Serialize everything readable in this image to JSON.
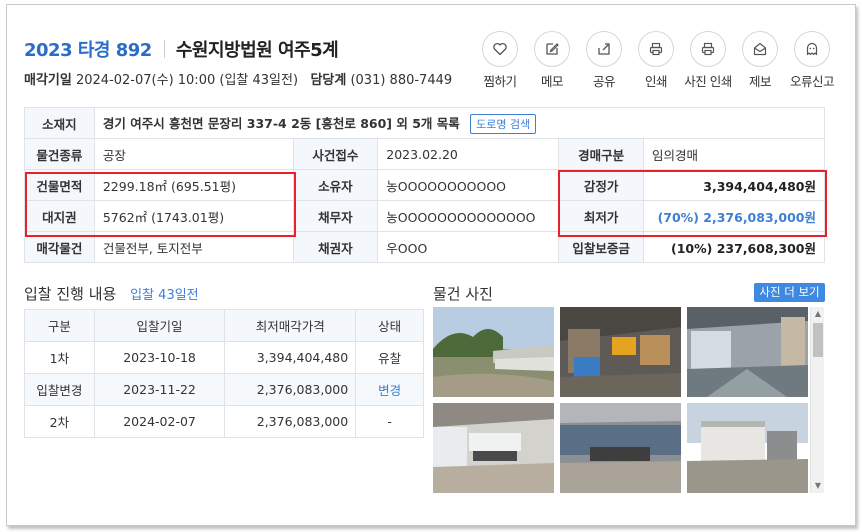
{
  "header": {
    "case_number": "2023 타경 892",
    "court": "수원지방법원 여주5계",
    "sale_date_label": "매각기일",
    "sale_date_value": "2024-02-07(수) 10:00 (입찰 43일전)",
    "manager_label": "담당계",
    "manager_phone": "(031) 880-7449"
  },
  "actions": [
    {
      "label": "찜하기",
      "icon": "heart-icon"
    },
    {
      "label": "메모",
      "icon": "memo-icon"
    },
    {
      "label": "공유",
      "icon": "share-icon"
    },
    {
      "label": "인쇄",
      "icon": "print-icon"
    },
    {
      "label": "사진 인쇄",
      "icon": "print-photo-icon"
    },
    {
      "label": "제보",
      "icon": "report-mail-icon"
    },
    {
      "label": "오류신고",
      "icon": "ghost-icon"
    }
  ],
  "info": {
    "location_label": "소재지",
    "location_value": "경기 여주시 흥천면 문장리 337-4 2동 [흥천로 860] 외 5개 목록",
    "road_search_label": "도로명 검색",
    "type_label": "물건종류",
    "type_value": "공장",
    "filed_label": "사건접수",
    "filed_value": "2023.02.20",
    "auction_type_label": "경매구분",
    "auction_type_value": "임의경매",
    "building_area_label": "건물면적",
    "building_area_value": "2299.18㎡ (695.51평)",
    "owner_label": "소유자",
    "owner_value": "농OOOOOOOOOOO",
    "appraisal_label": "감정가",
    "appraisal_value": "3,394,404,480원",
    "land_right_label": "대지권",
    "land_right_value": "5762㎡ (1743.01평)",
    "debtor_label": "채무자",
    "debtor_value": "농OOOOOOOOOOOOOO",
    "min_price_label": "최저가",
    "min_price_value": "(70%) 2,376,083,000원",
    "sale_items_label": "매각물건",
    "sale_items_value": "건물전부, 토지전부",
    "creditor_label": "채권자",
    "creditor_value": "우OOO",
    "deposit_label": "입찰보증금",
    "deposit_value": "(10%) 237,608,300원"
  },
  "progress": {
    "title": "입찰 진행 내용",
    "days_left": "입찰 43일전",
    "columns": [
      "구분",
      "입찰기일",
      "최저매각가격",
      "상태"
    ],
    "rows": [
      {
        "round": "1차",
        "date": "2023-10-18",
        "price": "3,394,404,480",
        "status": "유찰"
      },
      {
        "round": "입찰변경",
        "date": "2023-11-22",
        "price": "2,376,083,000",
        "status": "변경"
      },
      {
        "round": "2차",
        "date": "2024-02-07",
        "price": "2,376,083,000",
        "status": "-"
      }
    ]
  },
  "photos": {
    "title": "물건 사진",
    "more_label": "사진 더 보기"
  },
  "colors": {
    "accent": "#2a6dc9",
    "link": "#3f7fd6",
    "highlight": "#e8222a",
    "header_bg": "#f4f7fb"
  }
}
